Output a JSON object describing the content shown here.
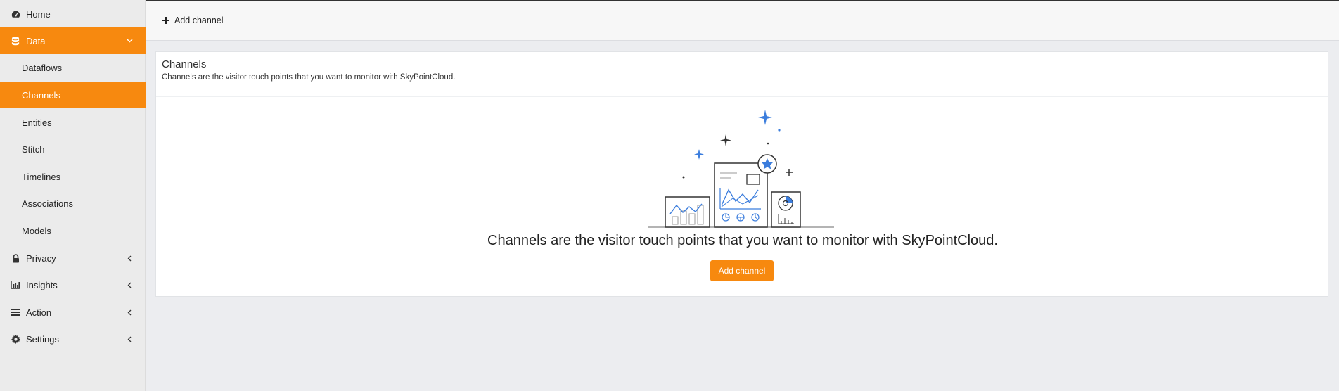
{
  "sidebar": {
    "items": [
      {
        "label": "Home",
        "icon": "dashboard-icon"
      },
      {
        "label": "Data",
        "icon": "database-icon",
        "expanded": true
      },
      {
        "label": "Privacy",
        "icon": "lock-icon"
      },
      {
        "label": "Insights",
        "icon": "bar-chart-icon"
      },
      {
        "label": "Action",
        "icon": "list-icon"
      },
      {
        "label": "Settings",
        "icon": "gear-icon"
      }
    ],
    "data_subitems": [
      "Dataflows",
      "Channels",
      "Entities",
      "Stitch",
      "Timelines",
      "Associations",
      "Models"
    ],
    "active_subitem": "Channels"
  },
  "toolbar": {
    "add_label": "Add channel"
  },
  "card": {
    "title": "Channels",
    "subtitle": "Channels are the visitor touch points that you want to monitor with SkyPointCloud.",
    "empty_message": "Channels are the visitor touch points that you want to monitor with SkyPointCloud.",
    "button_label": "Add channel"
  },
  "colors": {
    "accent": "#f7890f",
    "illustration_blue": "#3b7ddd",
    "background": "#ecedf0"
  }
}
